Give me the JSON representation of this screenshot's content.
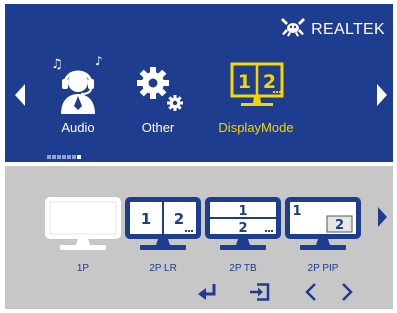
{
  "brand": {
    "name": "REALTEK",
    "logo_icon": "realtek-crab-logo-icon"
  },
  "menu": {
    "prev_icon": "triangle-left-icon",
    "next_icon": "triangle-right-icon",
    "items": [
      {
        "label": "Audio",
        "icon": "headphones-person-icon",
        "selected": false
      },
      {
        "label": "Other",
        "icon": "gears-icon",
        "selected": false
      },
      {
        "label": "DisplayMode",
        "icon": "split-screen-icon",
        "selected": true,
        "icon_digits": [
          "1",
          "2"
        ]
      }
    ],
    "page_indicator": {
      "count": 7,
      "active_index": 6
    }
  },
  "modes": {
    "next_icon": "triangle-right-icon",
    "options": [
      {
        "label": "1P",
        "selected": true
      },
      {
        "label": "2P LR",
        "digits": [
          "1",
          "2"
        ],
        "selected": false
      },
      {
        "label": "2P TB",
        "digits": [
          "1",
          "2"
        ],
        "selected": false
      },
      {
        "label": "2P PIP",
        "digits": [
          "1",
          "2"
        ],
        "selected": false
      }
    ]
  },
  "footer": {
    "buttons": [
      "enter-icon",
      "exit-icon",
      "left-chevron-icon",
      "right-chevron-icon"
    ]
  },
  "colors": {
    "panel_blue": "#1f3d8f",
    "panel_grey": "#c7c7c7",
    "accent_yellow": "#f5d600",
    "selected_white": "#ffffff"
  }
}
